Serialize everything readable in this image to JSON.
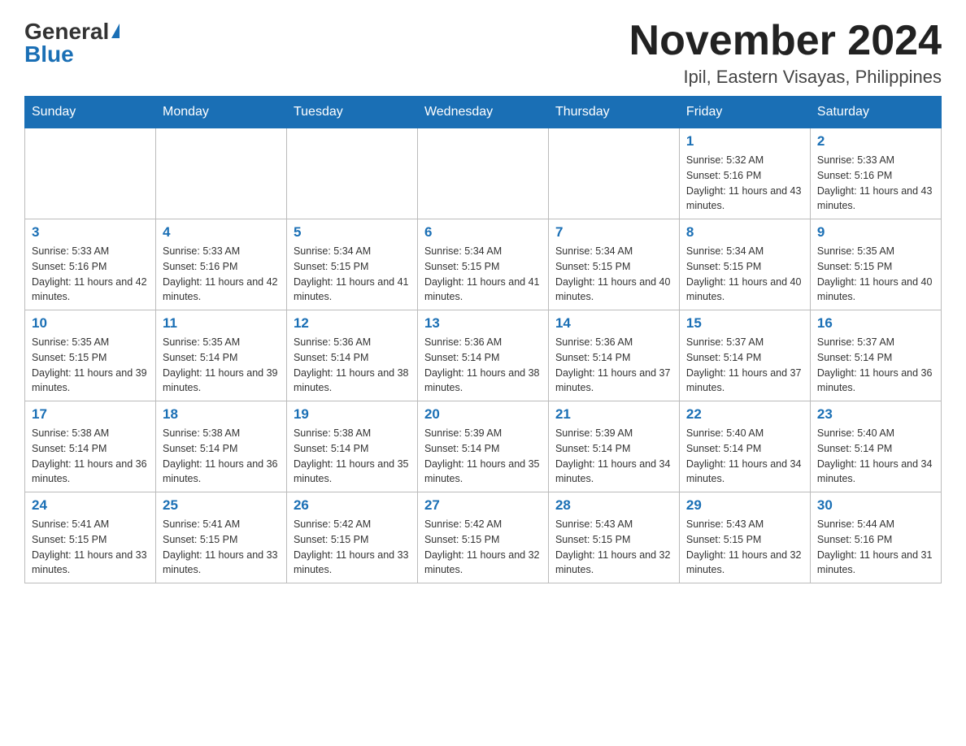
{
  "logo": {
    "general": "General",
    "blue": "Blue"
  },
  "title": "November 2024",
  "location": "Ipil, Eastern Visayas, Philippines",
  "weekdays": [
    "Sunday",
    "Monday",
    "Tuesday",
    "Wednesday",
    "Thursday",
    "Friday",
    "Saturday"
  ],
  "weeks": [
    [
      {
        "day": "",
        "info": ""
      },
      {
        "day": "",
        "info": ""
      },
      {
        "day": "",
        "info": ""
      },
      {
        "day": "",
        "info": ""
      },
      {
        "day": "",
        "info": ""
      },
      {
        "day": "1",
        "info": "Sunrise: 5:32 AM\nSunset: 5:16 PM\nDaylight: 11 hours and 43 minutes."
      },
      {
        "day": "2",
        "info": "Sunrise: 5:33 AM\nSunset: 5:16 PM\nDaylight: 11 hours and 43 minutes."
      }
    ],
    [
      {
        "day": "3",
        "info": "Sunrise: 5:33 AM\nSunset: 5:16 PM\nDaylight: 11 hours and 42 minutes."
      },
      {
        "day": "4",
        "info": "Sunrise: 5:33 AM\nSunset: 5:16 PM\nDaylight: 11 hours and 42 minutes."
      },
      {
        "day": "5",
        "info": "Sunrise: 5:34 AM\nSunset: 5:15 PM\nDaylight: 11 hours and 41 minutes."
      },
      {
        "day": "6",
        "info": "Sunrise: 5:34 AM\nSunset: 5:15 PM\nDaylight: 11 hours and 41 minutes."
      },
      {
        "day": "7",
        "info": "Sunrise: 5:34 AM\nSunset: 5:15 PM\nDaylight: 11 hours and 40 minutes."
      },
      {
        "day": "8",
        "info": "Sunrise: 5:34 AM\nSunset: 5:15 PM\nDaylight: 11 hours and 40 minutes."
      },
      {
        "day": "9",
        "info": "Sunrise: 5:35 AM\nSunset: 5:15 PM\nDaylight: 11 hours and 40 minutes."
      }
    ],
    [
      {
        "day": "10",
        "info": "Sunrise: 5:35 AM\nSunset: 5:15 PM\nDaylight: 11 hours and 39 minutes."
      },
      {
        "day": "11",
        "info": "Sunrise: 5:35 AM\nSunset: 5:14 PM\nDaylight: 11 hours and 39 minutes."
      },
      {
        "day": "12",
        "info": "Sunrise: 5:36 AM\nSunset: 5:14 PM\nDaylight: 11 hours and 38 minutes."
      },
      {
        "day": "13",
        "info": "Sunrise: 5:36 AM\nSunset: 5:14 PM\nDaylight: 11 hours and 38 minutes."
      },
      {
        "day": "14",
        "info": "Sunrise: 5:36 AM\nSunset: 5:14 PM\nDaylight: 11 hours and 37 minutes."
      },
      {
        "day": "15",
        "info": "Sunrise: 5:37 AM\nSunset: 5:14 PM\nDaylight: 11 hours and 37 minutes."
      },
      {
        "day": "16",
        "info": "Sunrise: 5:37 AM\nSunset: 5:14 PM\nDaylight: 11 hours and 36 minutes."
      }
    ],
    [
      {
        "day": "17",
        "info": "Sunrise: 5:38 AM\nSunset: 5:14 PM\nDaylight: 11 hours and 36 minutes."
      },
      {
        "day": "18",
        "info": "Sunrise: 5:38 AM\nSunset: 5:14 PM\nDaylight: 11 hours and 36 minutes."
      },
      {
        "day": "19",
        "info": "Sunrise: 5:38 AM\nSunset: 5:14 PM\nDaylight: 11 hours and 35 minutes."
      },
      {
        "day": "20",
        "info": "Sunrise: 5:39 AM\nSunset: 5:14 PM\nDaylight: 11 hours and 35 minutes."
      },
      {
        "day": "21",
        "info": "Sunrise: 5:39 AM\nSunset: 5:14 PM\nDaylight: 11 hours and 34 minutes."
      },
      {
        "day": "22",
        "info": "Sunrise: 5:40 AM\nSunset: 5:14 PM\nDaylight: 11 hours and 34 minutes."
      },
      {
        "day": "23",
        "info": "Sunrise: 5:40 AM\nSunset: 5:14 PM\nDaylight: 11 hours and 34 minutes."
      }
    ],
    [
      {
        "day": "24",
        "info": "Sunrise: 5:41 AM\nSunset: 5:15 PM\nDaylight: 11 hours and 33 minutes."
      },
      {
        "day": "25",
        "info": "Sunrise: 5:41 AM\nSunset: 5:15 PM\nDaylight: 11 hours and 33 minutes."
      },
      {
        "day": "26",
        "info": "Sunrise: 5:42 AM\nSunset: 5:15 PM\nDaylight: 11 hours and 33 minutes."
      },
      {
        "day": "27",
        "info": "Sunrise: 5:42 AM\nSunset: 5:15 PM\nDaylight: 11 hours and 32 minutes."
      },
      {
        "day": "28",
        "info": "Sunrise: 5:43 AM\nSunset: 5:15 PM\nDaylight: 11 hours and 32 minutes."
      },
      {
        "day": "29",
        "info": "Sunrise: 5:43 AM\nSunset: 5:15 PM\nDaylight: 11 hours and 32 minutes."
      },
      {
        "day": "30",
        "info": "Sunrise: 5:44 AM\nSunset: 5:16 PM\nDaylight: 11 hours and 31 minutes."
      }
    ]
  ]
}
